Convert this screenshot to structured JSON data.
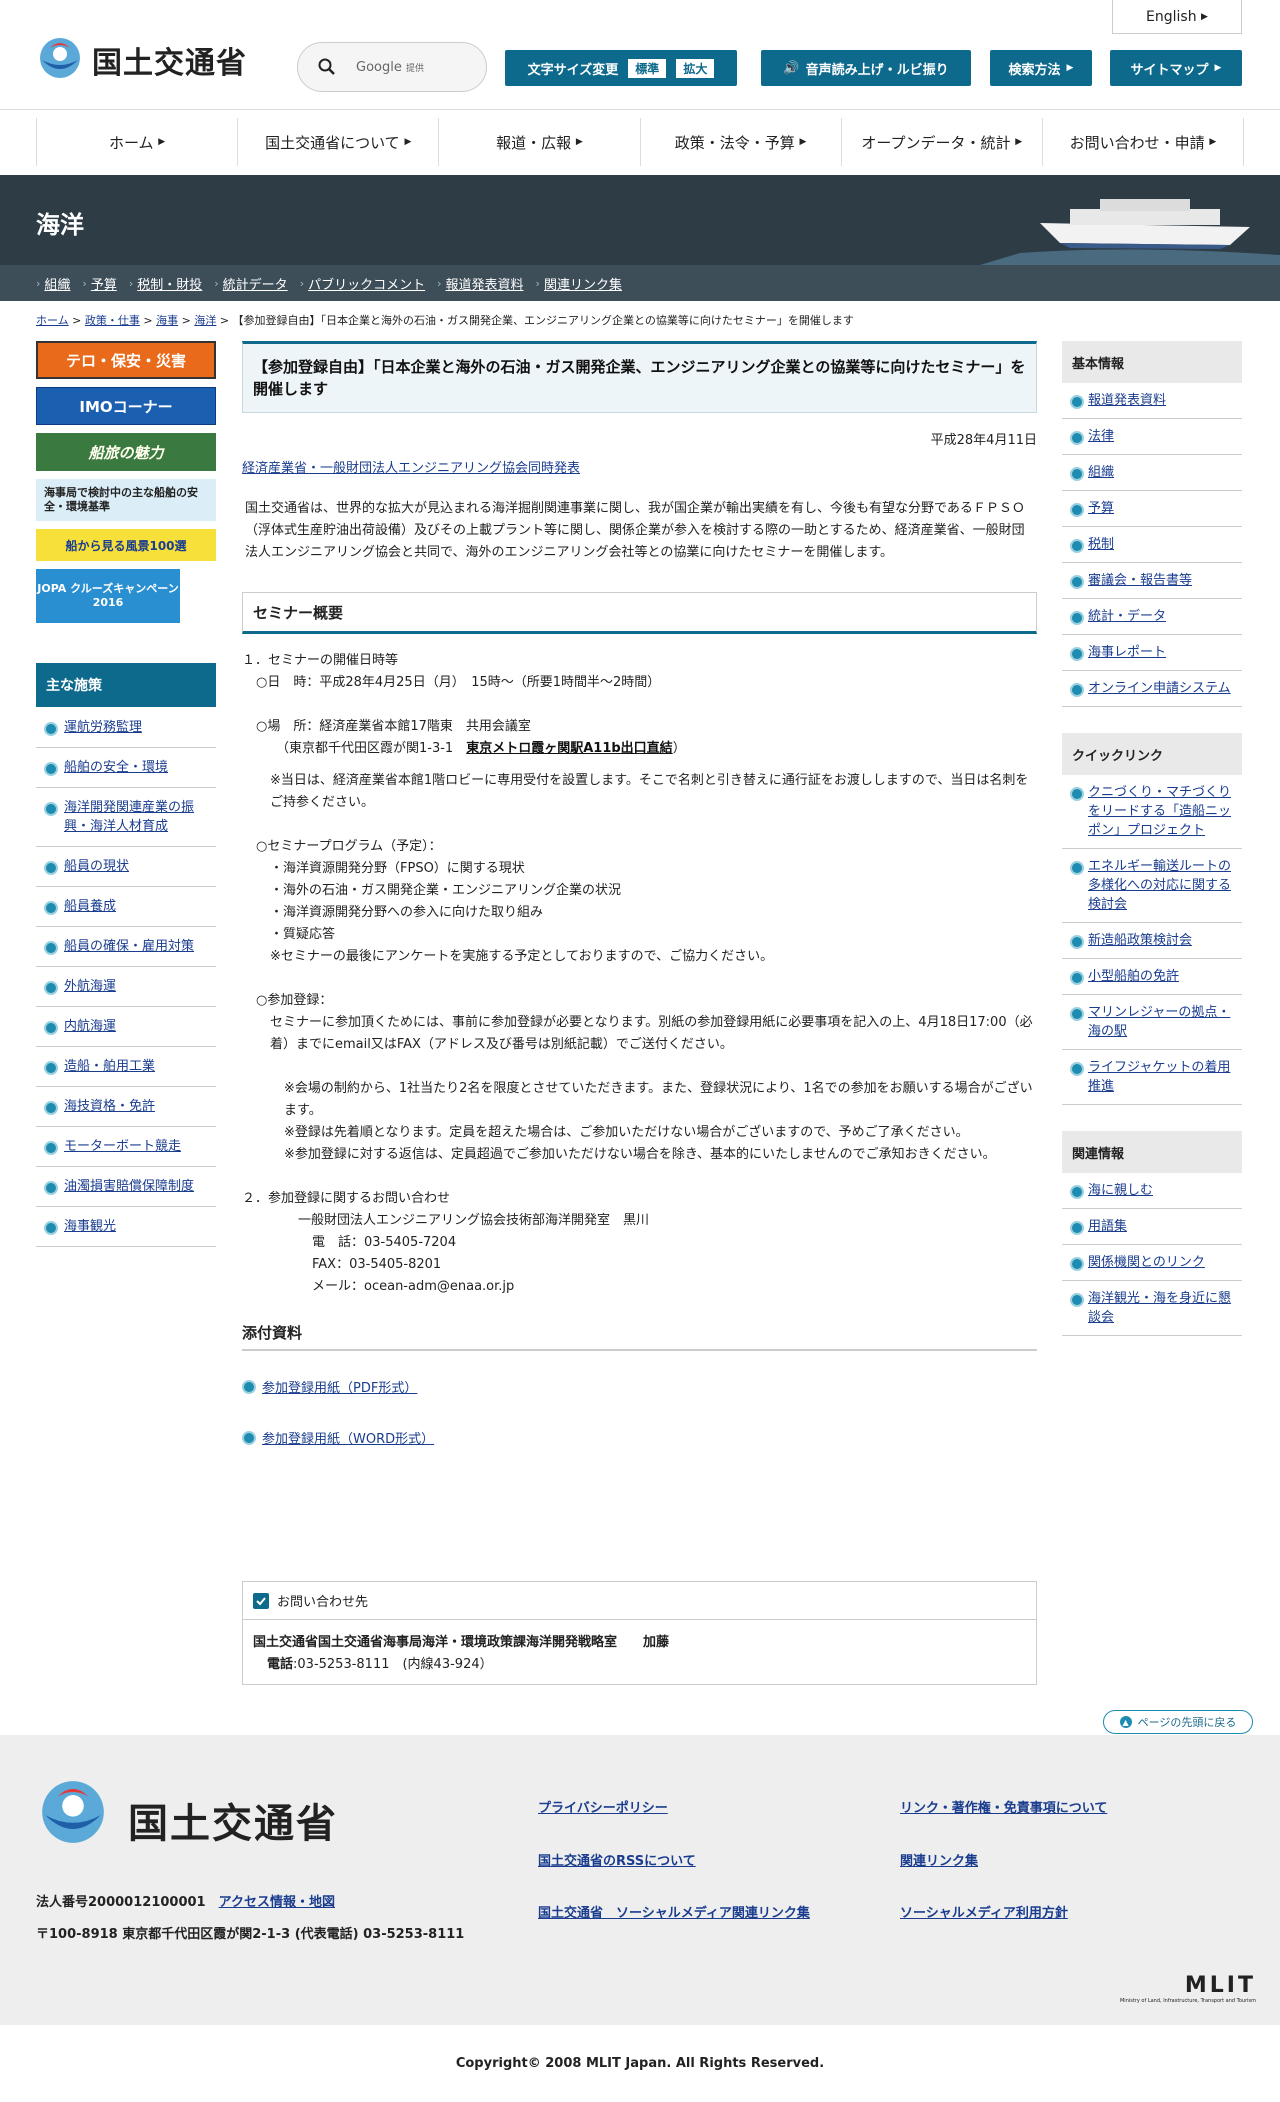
{
  "header": {
    "logo_text": "国土交通省",
    "english": "English",
    "search_placeholder": "Google",
    "search_provider": "提供",
    "font_size_label": "文字サイズ変更",
    "font_standard": "標準",
    "font_large": "拡大",
    "speech_label": "音声読み上げ・ルビ振り",
    "search_method": "検索方法",
    "sitemap": "サイトマップ"
  },
  "gnav": [
    "ホーム",
    "国土交通省について",
    "報道・広報",
    "政策・法令・予算",
    "オープンデータ・統計",
    "お問い合わせ・申請"
  ],
  "banner": {
    "title": "海洋"
  },
  "subnav": [
    "組織",
    "予算",
    "税制・財投",
    "統計データ",
    "パブリックコメント",
    "報道発表資料",
    "関連リンク集"
  ],
  "breadcrumb": {
    "items": [
      "ホーム",
      "政策・仕事",
      "海事",
      "海洋"
    ],
    "current": "【参加登録自由】「日本企業と海外の石油・ガス開発企業、エンジニアリング企業との協業等に向けたセミナー」を開催します"
  },
  "left_banners": [
    "テロ・保安・災害",
    "IMOコーナー",
    "船旅の魅力",
    "海事局で検討中の主な船舶の安全・環境基準",
    "船から見る風景100選",
    "JOPA クルーズキャンペーン 2016"
  ],
  "policy": {
    "title": "主な施策",
    "items": [
      "運航労務監理",
      "船舶の安全・環境",
      "海洋開発関連産業の振興・海洋人材育成",
      "船員の現状",
      "船員養成",
      "船員の確保・雇用対策",
      "外航海運",
      "内航海運",
      "造船・舶用工業",
      "海技資格・免許",
      "モーターボート競走",
      "油濁損害賠償保障制度",
      "海事観光"
    ]
  },
  "right": {
    "basic_title": "基本情報",
    "basic_items": [
      "報道発表資料",
      "法律",
      "組織",
      "予算",
      "税制",
      "審議会・報告書等",
      "統計・データ",
      "海事レポート",
      "オンライン申請システム"
    ],
    "quick_title": "クイックリンク",
    "quick_items": [
      "クニづくり・マチづくりをリードする「造船ニッポン」プロジェクト",
      "エネルギー輸送ルートの多様化への対応に関する検討会",
      "新造船政策検討会",
      "小型船舶の免許",
      "マリンレジャーの拠点・海の駅",
      "ライフジャケットの着用推進"
    ],
    "related_title": "関連情報",
    "related_items": [
      "海に親しむ",
      "用語集",
      "関係機関とのリンク",
      "海洋観光・海を身近に懇談会"
    ]
  },
  "main": {
    "title": "【参加登録自由】「日本企業と海外の石油・ガス開発企業、エンジニアリング企業との協業等に向けたセミナー」を開催します",
    "date": "平成28年4月11日",
    "joint": "経済産業省・一般財団法人エンジニアリング協会同時発表",
    "intro": "国土交通省は、世界的な拡大が見込まれる海洋掘削関連事業に関し、我が国企業が輸出実績を有し、今後も有望な分野であるＦＰＳＯ（浮体式生産貯油出荷設備）及びその上載プラント等に関し、関係企業が参入を検討する際の一助とするため、経済産業省、一般財団法人エンジニアリング協会と共同で、海外のエンジニアリング会社等との協業に向けたセミナーを開催します。",
    "seminar_heading": "セミナー概要",
    "s1_title": "１．セミナーの開催日時等",
    "s1_date": "○日　時：平成28年4月25日（月）　15時～（所要1時間半～2時間）",
    "s1_place": "○場　所：経済産業省本館17階東　共用会議室",
    "s1_address": "（東京都千代田区霞が関1-3-1",
    "s1_station": "東京メトロ霞ヶ関駅A11b出口直結",
    "s1_address_end": "）",
    "s1_note": "※当日は、経済産業省本館1階ロビーに専用受付を設置します。そこで名刺と引き替えに通行証をお渡ししますので、当日は名刺をご持参ください。",
    "program_title": "○セミナープログラム（予定）：",
    "program": [
      "・海洋資源開発分野（FPSO）に関する現状",
      "・海外の石油・ガス開発企業・エンジニアリング企業の状況",
      "・海洋資源開発分野への参入に向けた取り組み",
      "・質疑応答",
      "※セミナーの最後にアンケートを実施する予定としておりますので、ご協力ください。"
    ],
    "reg_title": "○参加登録：",
    "reg_text": "セミナーに参加頂くためには、事前に参加登録が必要となります。別紙の参加登録用紙に必要事項を記入の上、4月18日17:00（必着）までにemail又はFAX（アドレス及び番号は別紙記載）でご送付ください。",
    "reg_notes": [
      "※会場の制約から、1社当たり2名を限度とさせていただきます。また、登録状況により、1名での参加をお願いする場合がございます。",
      "※登録は先着順となります。定員を超えた場合は、ご参加いただけない場合がございますので、予めご了承ください。",
      "※参加登録に対する返信は、定員超過でご参加いただけない場合を除き、基本的にいたしませんのでご承知おきください。"
    ],
    "s2_title": "２．参加登録に関するお問い合わせ",
    "s2_org": "一般財団法人エンジニアリング協会技術部海洋開発室　黒川",
    "s2_tel": "電　話：03-5405-7204",
    "s2_fax": "FAX：03-5405-8201",
    "s2_mail": "メール：ocean-adm@enaa.or.jp",
    "attach_heading": "添付資料",
    "attach": [
      "参加登録用紙（PDF形式）",
      "参加登録用紙（WORD形式）"
    ]
  },
  "contact": {
    "head": "お問い合わせ先",
    "org": "国土交通省国土交通省海事局海洋・環境政策課海洋開発戦略室　　加藤",
    "tel_label": "電話",
    "tel": ":03-5253-8111　(内線43-924）"
  },
  "pagetop": "ページの先頭に戻る",
  "footer": {
    "logo_text": "国土交通省",
    "links": [
      "プライバシーポリシー",
      "リンク・著作権・免責事項について",
      "国土交通省のRSSについて",
      "関連リンク集",
      "国土交通省　ソーシャルメディア関連リンク集",
      "ソーシャルメディア利用方針"
    ],
    "corp_number": "法人番号2000012100001",
    "access": "アクセス情報・地図",
    "address": "〒100-8918 東京都千代田区霞が関2-1-3 (代表電話) 03-5253-8111",
    "mlit": "MLIT",
    "mlit_sub": "Ministry of Land, Infrastructure, Transport and Tourism",
    "copyright": "Copyright© 2008 MLIT Japan. All Rights Reserved."
  }
}
